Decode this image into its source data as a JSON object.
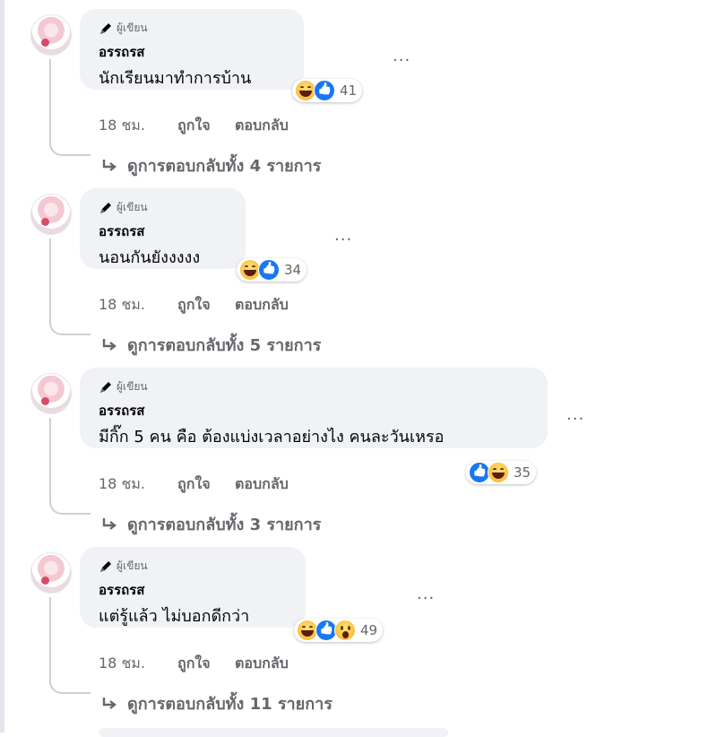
{
  "comments": [
    {
      "badge": "ผู้เขียน",
      "name": "อรรถรส",
      "text": "นักเรียนมาทำการบ้าน",
      "reaction_count": "41",
      "time": "18 ชม.",
      "like_label": "ถูกใจ",
      "reply_label": "ตอบกลับ",
      "view_replies": "ดูการตอบกลับทั้ง 4 รายการ"
    },
    {
      "badge": "ผู้เขียน",
      "name": "อรรถรส",
      "text": "นอนกันยังงงงง",
      "reaction_count": "34",
      "time": "18 ชม.",
      "like_label": "ถูกใจ",
      "reply_label": "ตอบกลับ",
      "view_replies": "ดูการตอบกลับทั้ง 5 รายการ"
    },
    {
      "badge": "ผู้เขียน",
      "name": "อรรถรส",
      "text": "มีกิ๊ก 5 คน คือ ต้องแบ่งเวลาอย่างไง คนละวันเหรอ",
      "reaction_count": "35",
      "time": "18 ชม.",
      "like_label": "ถูกใจ",
      "reply_label": "ตอบกลับ",
      "view_replies": "ดูการตอบกลับทั้ง 3 รายการ"
    },
    {
      "badge": "ผู้เขียน",
      "name": "อรรถรส",
      "text": "แต่รู้แล้ว ไม่บอกดีกว่า",
      "reaction_count": "49",
      "time": "18 ชม.",
      "like_label": "ถูกใจ",
      "reply_label": "ตอบกลับ",
      "view_replies": "ดูการตอบกลับทั้ง 11 รายการ"
    }
  ],
  "more_label": "...",
  "icons": {
    "badge": "pen-icon",
    "reply_arrow": "reply-arrow-icon",
    "reactions": [
      "haha-icon",
      "like-icon",
      "wow-icon"
    ]
  },
  "colors": {
    "bubble": "#f0f2f5",
    "secondary_text": "#65676b",
    "like_blue": "#1877f2"
  }
}
